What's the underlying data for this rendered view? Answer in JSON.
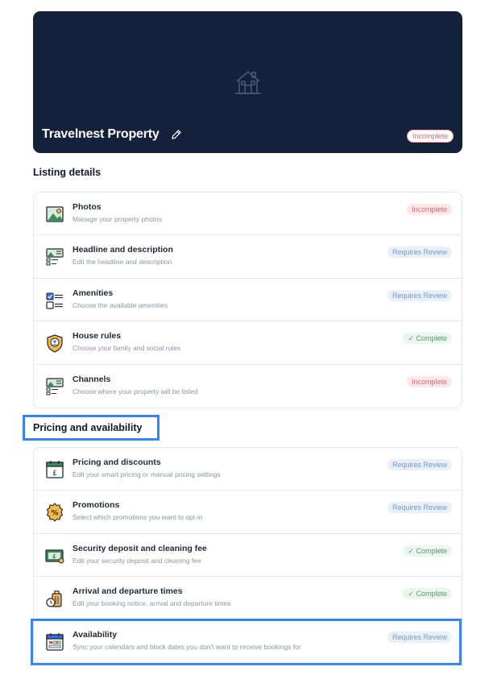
{
  "property": {
    "name": "Travelnest Property",
    "status": "Incomplete"
  },
  "sections": [
    {
      "title": "Listing details",
      "items": [
        {
          "icon": "photos-icon",
          "name": "Photos",
          "desc": "Manage your property photos",
          "status": "Incomplete",
          "status_type": "incomplete"
        },
        {
          "icon": "headline-icon",
          "name": "Headline and description",
          "desc": "Edit the headline and description",
          "status": "Requires Review",
          "status_type": "review"
        },
        {
          "icon": "amenities-icon",
          "name": "Amenities",
          "desc": "Choose the available amenities",
          "status": "Requires Review",
          "status_type": "review"
        },
        {
          "icon": "house-rules-icon",
          "name": "House rules",
          "desc": "Choose your family and social rules",
          "status": "✓ Complete",
          "status_type": "complete"
        },
        {
          "icon": "channels-icon",
          "name": "Channels",
          "desc": "Choose where your property will be listed",
          "status": "Incomplete",
          "status_type": "incomplete"
        }
      ]
    },
    {
      "title": "Pricing and availability",
      "items": [
        {
          "icon": "pricing-icon",
          "name": "Pricing and discounts",
          "desc": "Edit your smart pricing or manual pricing settings",
          "status": "Requires Review",
          "status_type": "review"
        },
        {
          "icon": "promotions-icon",
          "name": "Promotions",
          "desc": "Select which promotions you want to opt-in",
          "status": "Requires Review",
          "status_type": "review"
        },
        {
          "icon": "deposit-icon",
          "name": "Security deposit and cleaning fee",
          "desc": "Edit your security deposit and cleaning fee",
          "status": "✓ Complete",
          "status_type": "complete"
        },
        {
          "icon": "arrival-icon",
          "name": "Arrival and departure times",
          "desc": "Edit your booking notice, arrival and departure times",
          "status": "✓ Complete",
          "status_type": "complete"
        },
        {
          "icon": "availability-icon",
          "name": "Availability",
          "desc": "Sync your calendars and block dates you don't want to receive bookings for",
          "status": "Requires Review",
          "status_type": "review"
        }
      ]
    }
  ]
}
